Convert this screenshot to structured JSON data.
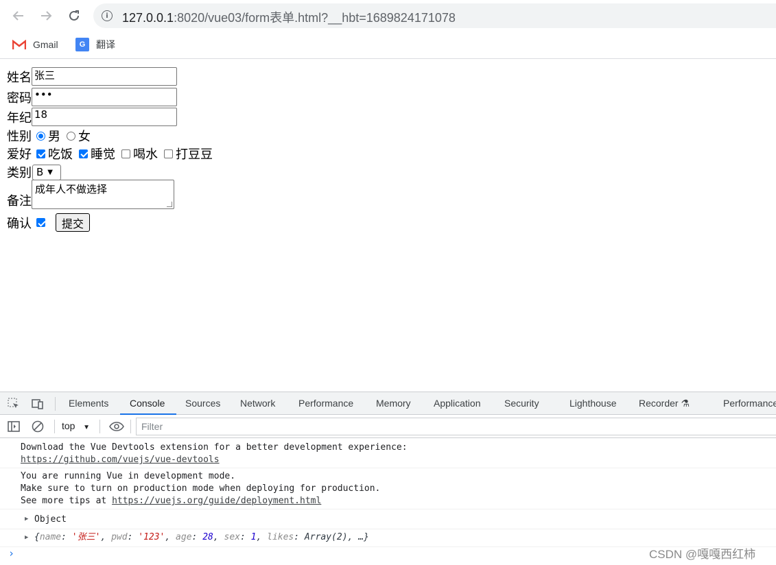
{
  "browser": {
    "url_host": "127.0.0.1",
    "url_path": ":8020/vue03/form表单.html?__hbt=1689824171078",
    "bookmarks": [
      {
        "label": "Gmail",
        "icon": "gmail-icon"
      },
      {
        "label": "翻译",
        "icon": "google-translate-icon"
      }
    ]
  },
  "form": {
    "name": {
      "label": "姓名",
      "value": "张三"
    },
    "password": {
      "label": "密码",
      "value": "•••"
    },
    "age": {
      "label": "年纪",
      "value": "18"
    },
    "sex": {
      "label": "性别",
      "options": [
        "男",
        "女"
      ],
      "selected": "男"
    },
    "hobby": {
      "label": "爱好",
      "options": [
        {
          "label": "吃饭",
          "checked": true
        },
        {
          "label": "睡觉",
          "checked": true
        },
        {
          "label": "喝水",
          "checked": false
        },
        {
          "label": "打豆豆",
          "checked": false
        }
      ]
    },
    "category": {
      "label": "类别",
      "value": "B"
    },
    "note": {
      "label": "备注",
      "value": "成年人不做选择"
    },
    "confirm": {
      "label": "确认",
      "checked": true
    },
    "submit_label": "提交"
  },
  "devtools": {
    "tabs": [
      "Elements",
      "Console",
      "Sources",
      "Network",
      "Performance",
      "Memory",
      "Application",
      "Security",
      "Lighthouse",
      "Recorder",
      "Performance"
    ],
    "active_tab": "Console",
    "context": "top",
    "filter_placeholder": "Filter",
    "messages": {
      "m1_line1": "Download the Vue Devtools extension for a better development experience:",
      "m1_link": "https://github.com/vuejs/vue-devtools",
      "m2_line1": "You are running Vue in development mode.",
      "m2_line2": "Make sure to turn on production mode when deploying for production.",
      "m2_line3_prefix": "See more tips at ",
      "m2_link": "https://vuejs.org/guide/deployment.html",
      "m3": "Object",
      "m4_open": "{",
      "m4_k1": "name",
      "m4_v1": "'张三'",
      "m4_k2": "pwd",
      "m4_v2": "'123'",
      "m4_k3": "age",
      "m4_v3": "28",
      "m4_k4": "sex",
      "m4_v4": "1",
      "m4_k5": "likes",
      "m4_v5": "Array(2)",
      "m4_tail": ", …}"
    }
  },
  "watermark": "CSDN @嘎嘎西红柿",
  "colors": {
    "accent": "#1a73e8",
    "checkbox": "#0075ff",
    "string": "#c41a16",
    "number": "#1c00cf"
  }
}
